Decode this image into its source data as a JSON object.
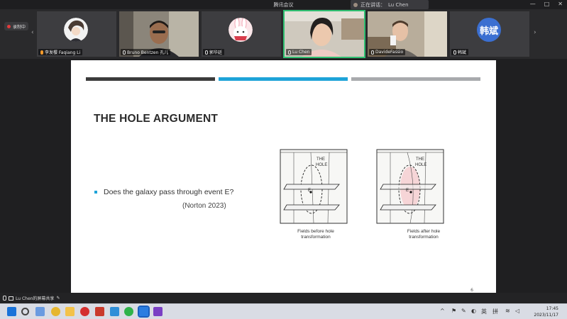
{
  "window": {
    "title": "腾讯会议",
    "speaking_label": "正在讲话：",
    "speaking_name": "Lu Chen",
    "minimize": "—",
    "maximize": "□",
    "close": "✕"
  },
  "recording": {
    "label": "录制中"
  },
  "participants": [
    {
      "name": "李发樱 Faqiang Li",
      "kind": "avatar-cartoon"
    },
    {
      "name": "Bruno Bentzen 孔儿",
      "kind": "video"
    },
    {
      "name": "郭华廷",
      "kind": "avatar-bunny"
    },
    {
      "name": "Lu Chen",
      "kind": "video",
      "active": true
    },
    {
      "name": "DavideFassio",
      "kind": "video"
    },
    {
      "name": "韩斌",
      "kind": "avatar-text",
      "avatar_text": "韩斌",
      "avatar_color": "#3b6fd1"
    }
  ],
  "slide": {
    "title": "THE HOLE ARGUMENT",
    "bullet": "Does the galaxy pass through event E?",
    "citation": "(Norton 2023)",
    "bar_colors": [
      "#3b3b3b",
      "#1ea3d8",
      "#a8aaad"
    ],
    "figure_left": {
      "label_the": "THE",
      "label_hole": "HOLE",
      "label_e": "E",
      "caption_line1": "Fields before hole",
      "caption_line2": "transformation"
    },
    "figure_right": {
      "label_the": "THE",
      "label_hole": "HOLE",
      "label_e": "E",
      "caption_line1": "Fields after hole",
      "caption_line2": "transformation"
    },
    "page_number": "6"
  },
  "share_bar": {
    "label": "Lu Chen的屏幕共享"
  },
  "taskbar": {
    "clock_time": "17:45",
    "clock_date": "2023/11/17",
    "ime": "拼",
    "lang": "英"
  }
}
